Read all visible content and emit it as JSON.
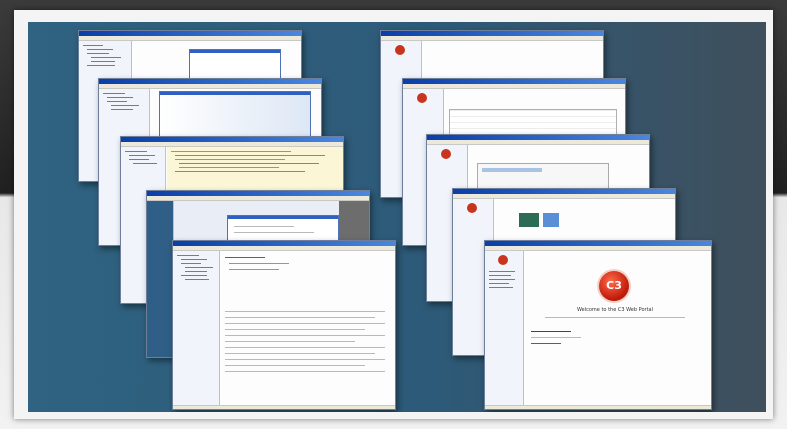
{
  "portal": {
    "logo_text": "C3",
    "welcome_text": "Welcome to the C3 Web Portal"
  },
  "windows_left": [
    {
      "name": "browser-window-1"
    },
    {
      "name": "browser-window-2"
    },
    {
      "name": "browser-window-3"
    },
    {
      "name": "browser-window-4"
    },
    {
      "name": "browser-window-5"
    }
  ],
  "windows_right": [
    {
      "name": "portal-window-1"
    },
    {
      "name": "portal-window-2"
    },
    {
      "name": "portal-window-3"
    },
    {
      "name": "portal-window-4"
    },
    {
      "name": "portal-window-5"
    }
  ],
  "colors": {
    "titlebar": "#0b3ea8",
    "desktop": "#2f6381",
    "logo": "#c21d0c"
  }
}
